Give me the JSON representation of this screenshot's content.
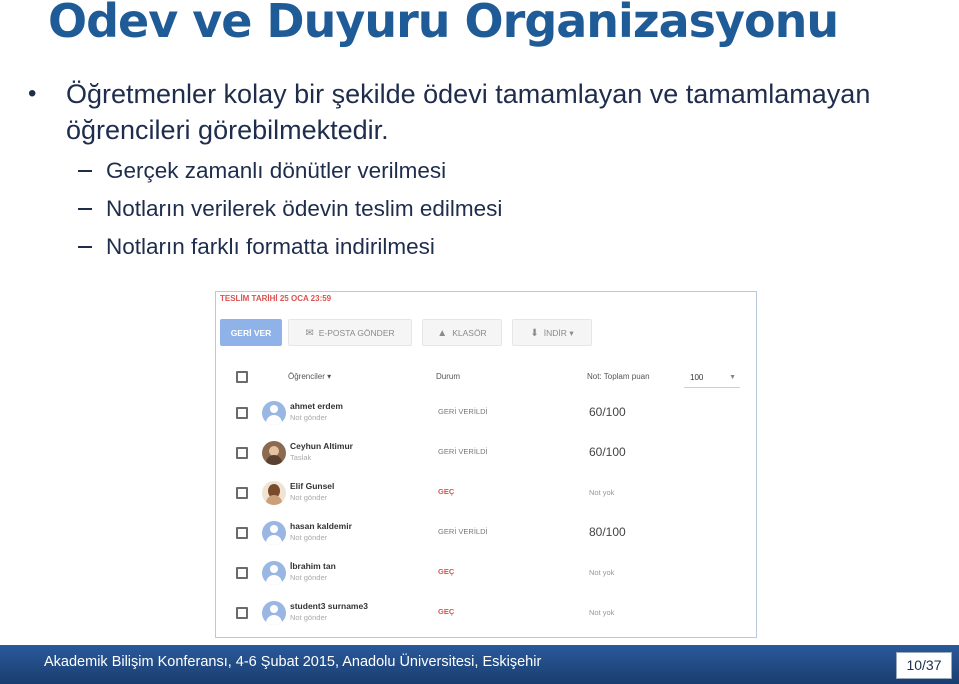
{
  "slide": {
    "title": "Ödev ve Duyuru Organizasyonu",
    "bullet_symbol": "•",
    "main_bullet": "Öğretmenler kolay bir şekilde ödevi tamamlayan ve tamamlamayan öğrencileri görebilmektedir.",
    "sub_bullets": [
      "Gerçek zamanlı dönütler verilmesi",
      "Notların verilerek ödevin teslim edilmesi",
      "Notların farklı formatta indirilmesi"
    ]
  },
  "screenshot": {
    "due_date": "TESLİM TARİHİ 25 OCA 23:59",
    "toolbar": {
      "return_label": "GERİ VER",
      "email_label": "E-POSTA GÖNDER",
      "email_icon": "envelope-icon",
      "folder_label": "KLASÖR",
      "folder_icon": "drive-icon",
      "download_label": "İNDİR",
      "download_icon": "download-icon"
    },
    "header": {
      "students": "Öğrenciler",
      "status": "Durum",
      "points": "Not: Toplam puan",
      "points_value": "100"
    },
    "rows": [
      {
        "name": "ahmet erdem",
        "sub": "Not gönder",
        "status": "GERİ VERİLDİ",
        "grade": "60/100"
      },
      {
        "name": "Ceyhun Altimur",
        "sub": "Taslak",
        "status": "GERİ VERİLDİ",
        "grade": "60/100"
      },
      {
        "name": "Elif Gunsel",
        "sub": "Not gönder",
        "status": "GEÇ",
        "grade": "Not yok"
      },
      {
        "name": "hasan kaldemir",
        "sub": "Not gönder",
        "status": "GERİ VERİLDİ",
        "grade": "80/100"
      },
      {
        "name": "İbrahim tan",
        "sub": "Not gönder",
        "status": "GEÇ",
        "grade": "Not yok"
      },
      {
        "name": "student3 surname3",
        "sub": "Not gönder",
        "status": "GEÇ",
        "grade": "Not yok"
      }
    ],
    "colors": {
      "primary_button": "#8fb3e8",
      "late": "#d9534f"
    }
  },
  "footer": {
    "text": "Akademik Bilişim Konferansı, 4-6 Şubat 2015, Anadolu Üniversitesi, Eskişehir",
    "page": "10/37"
  }
}
